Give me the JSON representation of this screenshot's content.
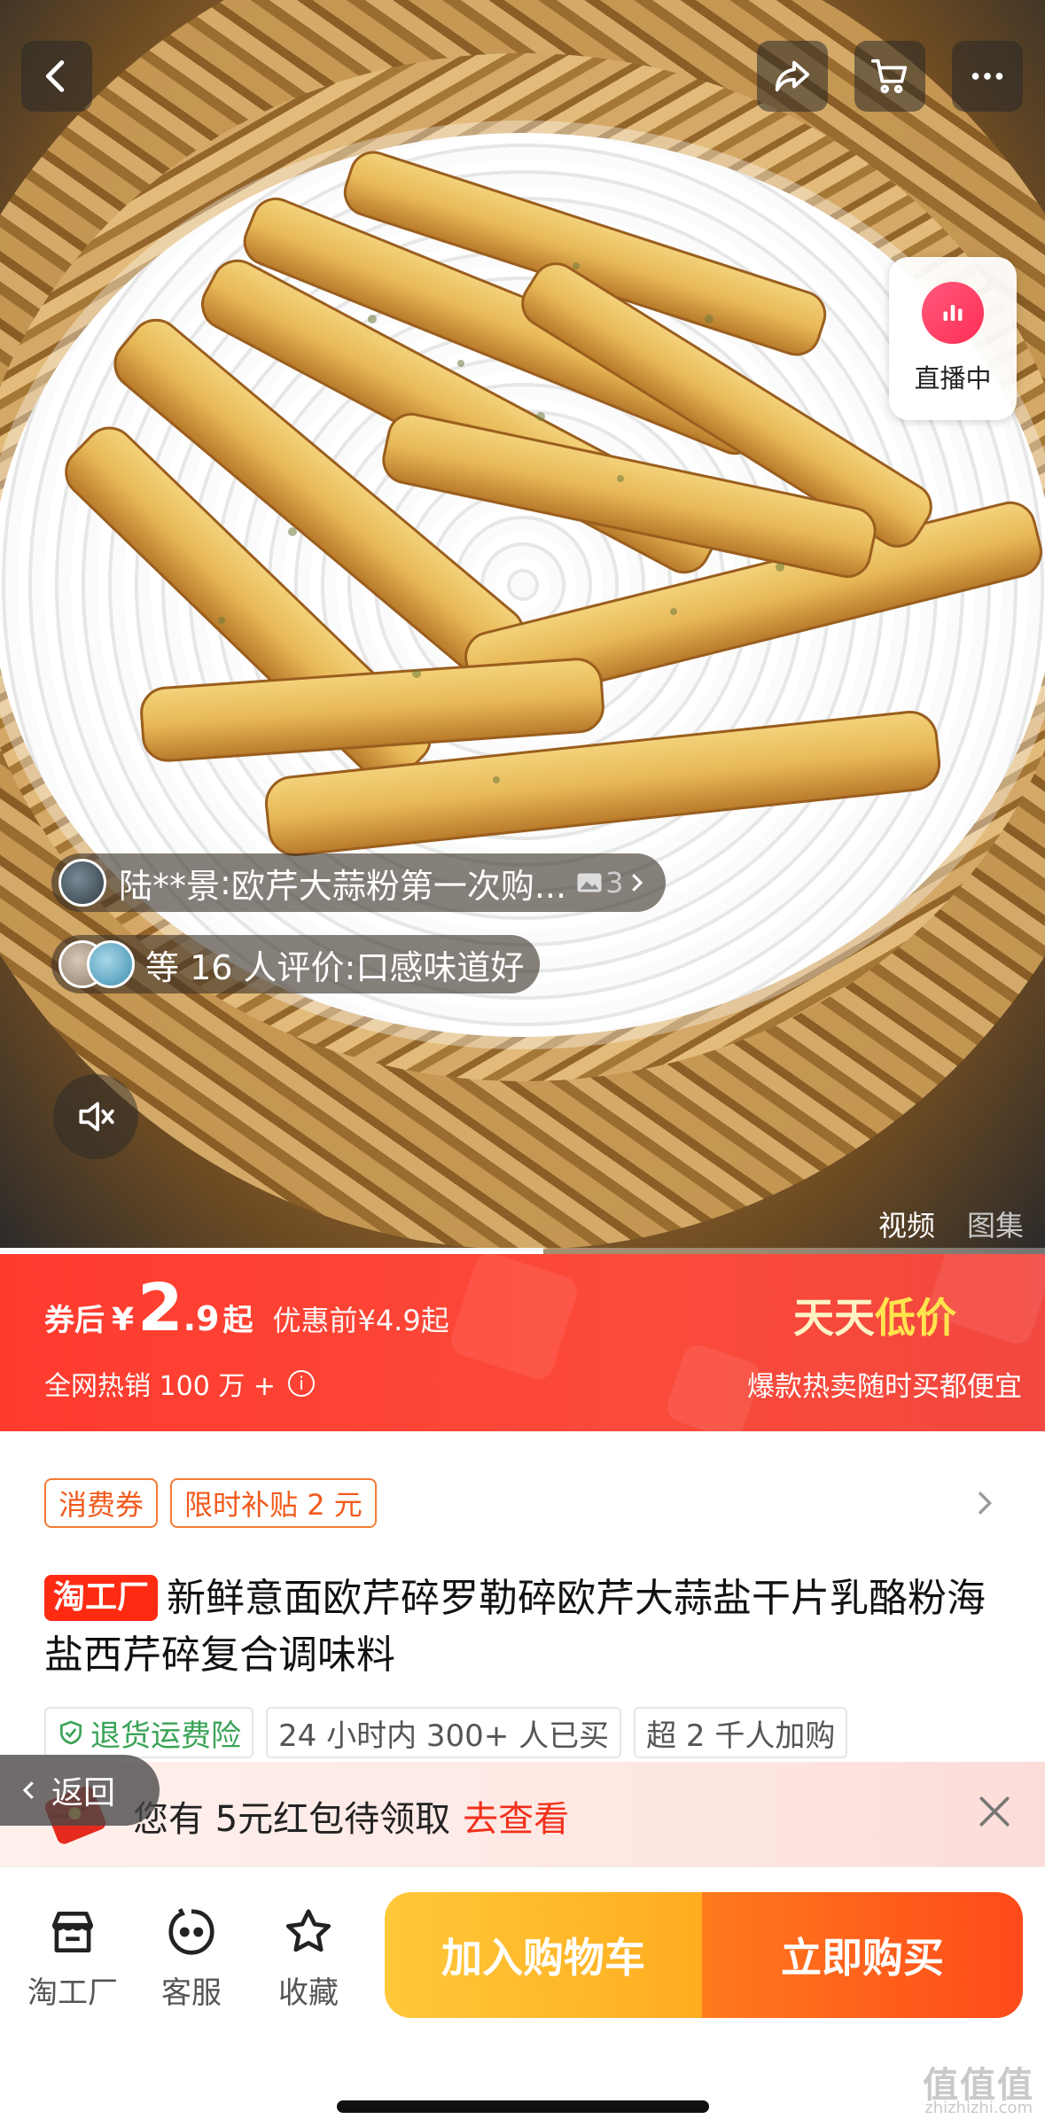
{
  "gallery": {
    "live_label": "直播中",
    "review_1": {
      "user": "陆**景",
      "text": "欧芹大蒜粉第一次购...",
      "photo_count": "3"
    },
    "review_2": {
      "text": "等 16 人评价:口感味道好"
    },
    "tabs": [
      {
        "label": "视频",
        "active": true
      },
      {
        "label": "图集",
        "active": false
      }
    ],
    "video_progress": 0.52
  },
  "price": {
    "label": "券后",
    "currency": "¥",
    "integer": "2",
    "decimal": ".9",
    "suffix": "起",
    "original": "优惠前¥4.9起",
    "sales": "全网热销 100 万 +",
    "info_icon": "i",
    "promo_title_a": "天天",
    "promo_title_b": "低价",
    "promo_sub": "爆款热卖随时买都便宜"
  },
  "coupons": [
    "消费券",
    "限时补贴 2 元"
  ],
  "product": {
    "brand_tag": "淘工厂",
    "title": "新鲜意面欧芹碎罗勒碎欧芹大蒜盐干片乳酪粉海盐西芹碎复合调味料"
  },
  "tags": [
    {
      "label": "退货运费险",
      "style": "green"
    },
    {
      "label": "24 小时内 300+ 人已买",
      "style": "plain"
    },
    {
      "label": "超 2 千人加购",
      "style": "plain"
    }
  ],
  "notification": {
    "text": "您有 5元红包待领取",
    "link": "去查看"
  },
  "back_button": "返回",
  "bottom_bar": {
    "store": "淘工厂",
    "service": "客服",
    "favorite": "收藏",
    "add_to_cart": "加入购物车",
    "buy_now": "立即购买"
  },
  "watermark": {
    "main": "值值值",
    "sub": "zhizhizhi.com"
  },
  "colors": {
    "price_red": "#ff3b2e",
    "cart_yellow": "#ffb62a",
    "buy_orange": "#ff5a1a",
    "coupon_orange": "#f25a1c",
    "insurance_green": "#3aa356"
  }
}
